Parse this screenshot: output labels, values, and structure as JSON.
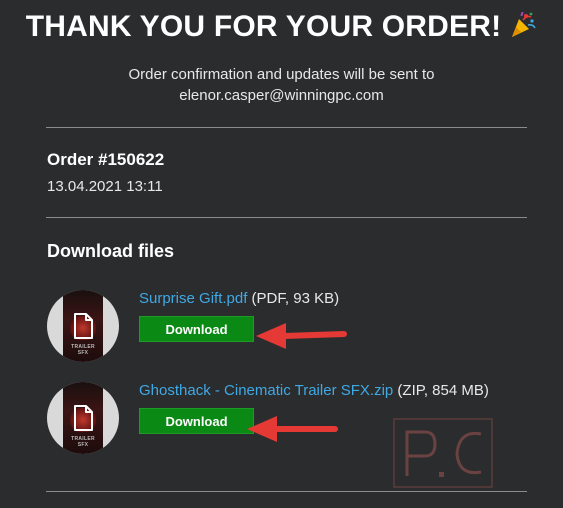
{
  "header": {
    "title": "THANK YOU FOR YOUR ORDER!",
    "subtitle_line1": "Order confirmation and updates will be sent to",
    "subtitle_line2": "elenor.casper@winningpc.com"
  },
  "order": {
    "number": "Order #150622",
    "date": "13.04.2021 13:11"
  },
  "downloads": {
    "section_title": "Download files",
    "items": [
      {
        "name": "Surprise Gift.pdf",
        "meta": " (PDF, 93 KB)",
        "button_label": "Download",
        "cover_text": "TRAILER SFX"
      },
      {
        "name": "Ghosthack - Cinematic Trailer SFX.zip",
        "meta": " (ZIP, 854 MB)",
        "button_label": "Download",
        "cover_text": "TRAILER SFX"
      }
    ]
  },
  "colors": {
    "background": "#2b2c2e",
    "link": "#3fa9e6",
    "download_button": "#0a8a14",
    "arrow": "#e53935"
  },
  "icons": {
    "title_decoration": "party-popper-icon",
    "file_type": "document-icon",
    "annotation": "arrow-left-icon"
  }
}
